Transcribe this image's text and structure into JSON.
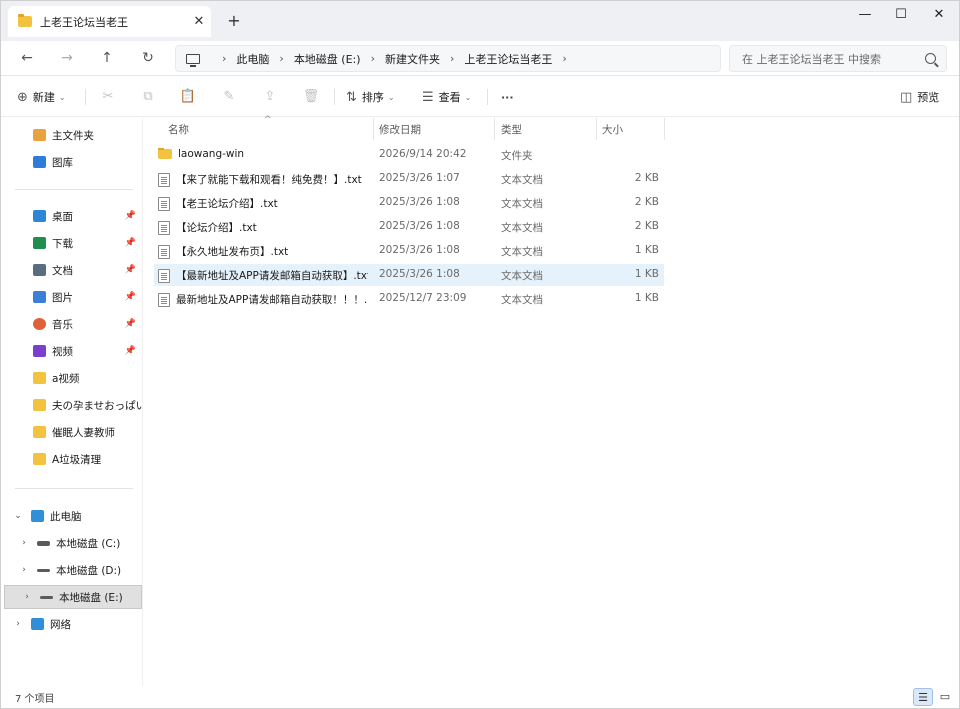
{
  "window": {
    "tab_title": "上老王论坛当老王",
    "tab_close": "✕",
    "new_tab": "+",
    "minimize": "—",
    "maximize": "☐",
    "close": "✕"
  },
  "nav": {
    "back": "←",
    "forward": "→",
    "up": "↑",
    "refresh": "↻",
    "breadcrumbs": [
      "此电脑",
      "本地磁盘 (E:)",
      "新建文件夹",
      "上老王论坛当老王"
    ],
    "sep": "›",
    "search_placeholder": "在 上老王论坛当老王 中搜索"
  },
  "commands": {
    "new_label": "新建",
    "sort_label": "排序",
    "view_label": "查看",
    "more": "···",
    "preview_label": "预览"
  },
  "sidebar": {
    "quick": [
      {
        "label": "主文件夹",
        "color": "#e8a33d"
      },
      {
        "label": "图库",
        "color": "#2f7bd9"
      }
    ],
    "pinned": [
      {
        "label": "桌面",
        "color": "#2d86d6",
        "pin": "📌"
      },
      {
        "label": "下载",
        "color": "#1f8f4e",
        "pin": "📌"
      },
      {
        "label": "文档",
        "color": "#5a6c80",
        "pin": "📌"
      },
      {
        "label": "图片",
        "color": "#3b7fd8",
        "pin": "📌"
      },
      {
        "label": "音乐",
        "color": "#e0603a",
        "pin": "📌"
      },
      {
        "label": "视频",
        "color": "#7b3fd0",
        "pin": "📌"
      },
      {
        "label": "a视频",
        "color": "#f3c23f"
      },
      {
        "label": "夫の孕ませおっぱい",
        "color": "#f3c23f"
      },
      {
        "label": "催眠人妻教师",
        "color": "#f3c23f"
      },
      {
        "label": "A垃圾清理",
        "color": "#f3c23f"
      }
    ],
    "tree": [
      {
        "label": "此电脑",
        "expand": "⌄",
        "color": "#2f8fd8"
      },
      {
        "label": "本地磁盘 (C:)",
        "expand": "›",
        "color": "#5b5b5b"
      },
      {
        "label": "本地磁盘 (D:)",
        "expand": "›",
        "color": "#5b5b5b"
      },
      {
        "label": "本地磁盘 (E:)",
        "expand": "›",
        "color": "#5b5b5b"
      },
      {
        "label": "网络",
        "expand": "›",
        "color": "#2f8fd8"
      }
    ]
  },
  "columns": {
    "name": "名称",
    "date": "修改日期",
    "type": "类型",
    "size": "大小",
    "sort_indicator": "^"
  },
  "files": [
    {
      "name": "laowang-win",
      "date": "2026/9/14 20:42",
      "type": "文件夹",
      "size": "",
      "kind": "folder"
    },
    {
      "name": "【来了就能下载和观看！纯免费！】.txt",
      "date": "2025/3/26 1:07",
      "type": "文本文档",
      "size": "2 KB",
      "kind": "txt"
    },
    {
      "name": "【老王论坛介绍】.txt",
      "date": "2025/3/26 1:08",
      "type": "文本文档",
      "size": "2 KB",
      "kind": "txt"
    },
    {
      "name": "【论坛介绍】.txt",
      "date": "2025/3/26 1:08",
      "type": "文本文档",
      "size": "2 KB",
      "kind": "txt"
    },
    {
      "name": "【永久地址发布页】.txt",
      "date": "2025/3/26 1:08",
      "type": "文本文档",
      "size": "1 KB",
      "kind": "txt"
    },
    {
      "name": "【最新地址及APP请发邮箱自动获取】.txt",
      "date": "2025/3/26 1:08",
      "type": "文本文档",
      "size": "1 KB",
      "kind": "txt"
    },
    {
      "name": "最新地址及APP请发邮箱自动获取！！！...",
      "date": "2025/12/7 23:09",
      "type": "文本文档",
      "size": "1 KB",
      "kind": "txt"
    }
  ],
  "status": {
    "item_count": "7 个项目",
    "details_view": "☰",
    "tiles_view": "▭"
  }
}
